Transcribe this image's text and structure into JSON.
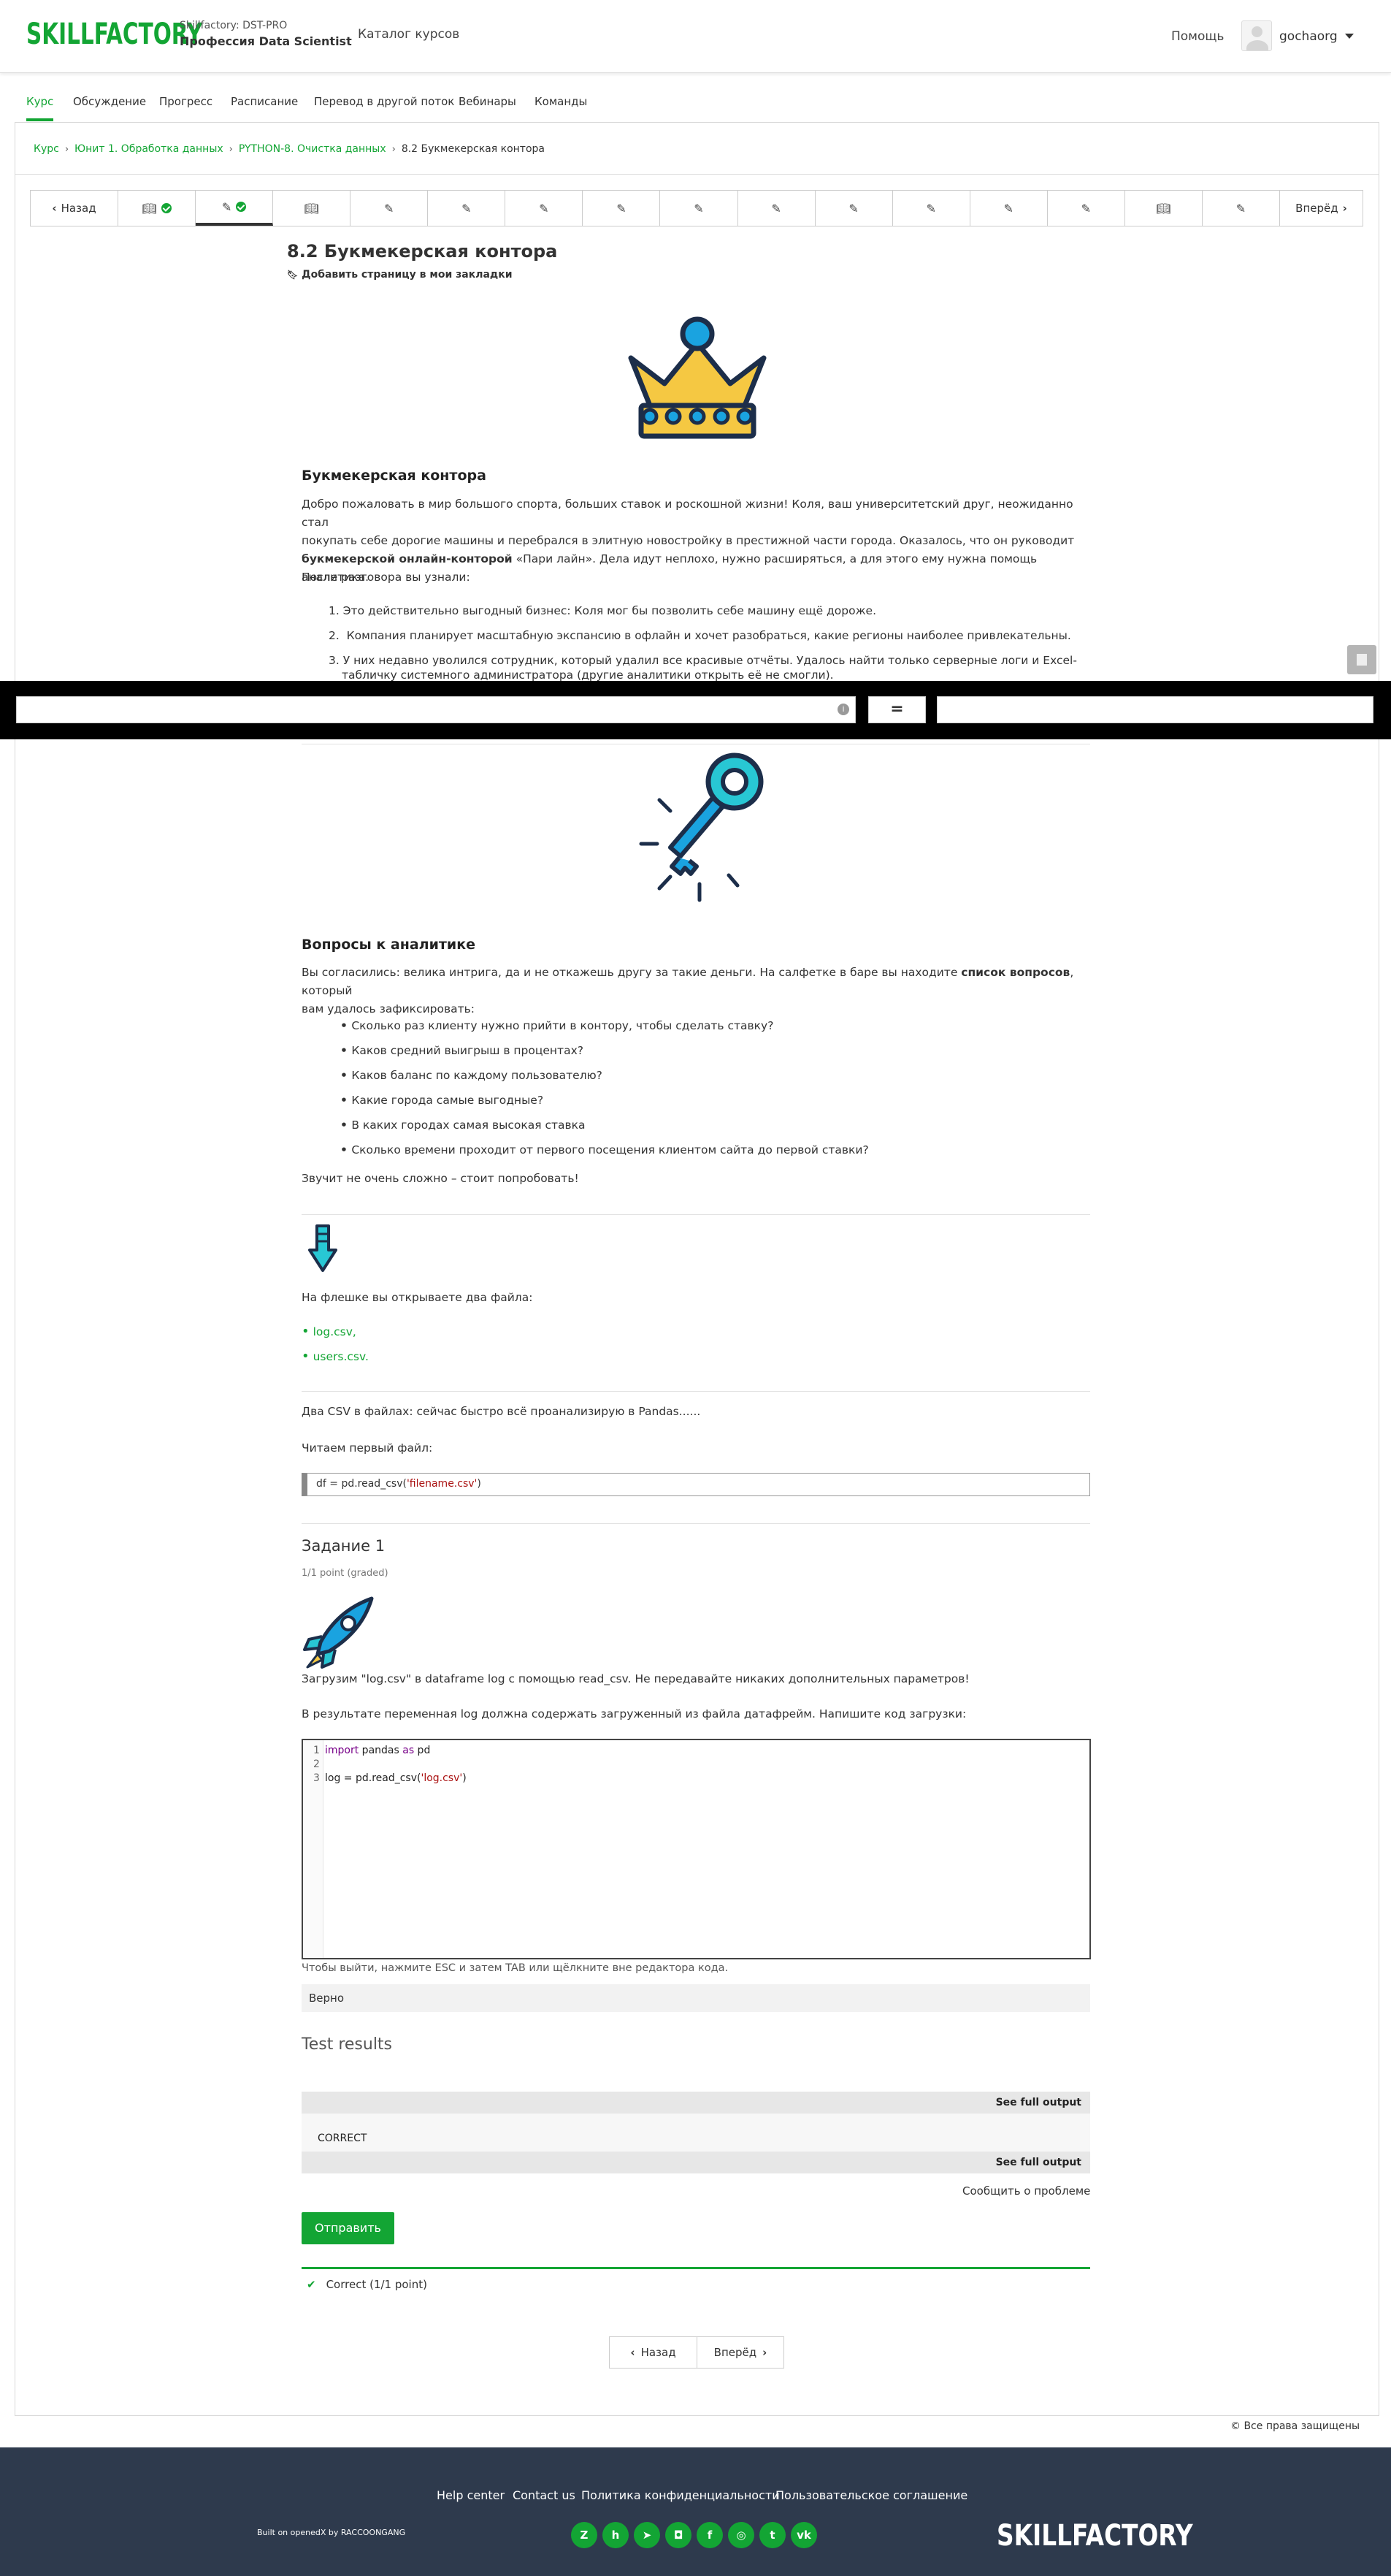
{
  "header": {
    "logo": "SKILLFACTORY",
    "org": "Skillfactory: DST-PRO",
    "program": "Профессия Data Scientist",
    "catalog": "Каталог курсов",
    "help": "Помощь",
    "username": "gochaorg"
  },
  "course_nav": {
    "tabs": [
      {
        "label": "Курс"
      },
      {
        "label": "Обсуждение"
      },
      {
        "label": "Прогресс"
      },
      {
        "label": "Расписание"
      },
      {
        "label": "Перевод в другой поток"
      },
      {
        "label": "Вебинары"
      },
      {
        "label": "Команды"
      }
    ]
  },
  "breadcrumb": {
    "items": [
      "Курс",
      "Юнит 1. Обработка данных",
      "PYTHON-8. Очистка данных",
      "8.2 Букмекерская контора"
    ]
  },
  "sequence": {
    "prev": "Назад",
    "next": "Вперёд",
    "units": [
      "book-check",
      "edit-check",
      "book",
      "edit",
      "edit",
      "edit",
      "edit",
      "edit",
      "edit",
      "edit",
      "edit",
      "edit",
      "edit",
      "book",
      "edit"
    ]
  },
  "page": {
    "title": "8.2 Букмекерская контора",
    "bookmark": "Добавить страницу в мои закладки",
    "intro_heading": "Букмекерская контора",
    "intro_p1": "Добро пожаловать в мир большого спорта, больших ставок и роскошной жизни! Коля, ваш университетский друг, неожиданно стал",
    "intro_p2a": "покупать себе дорогие машины и перебрался в элитную новостройку в престижной части города. Оказалось, что он руководит",
    "intro_p3_bold": "букмекерской онлайн-конторой",
    "intro_p3_rest": " «Пари лайн». Дела идут неплохо, нужно расширяться, а для этого ему нужна помощь аналитика.",
    "after_talk": "После разговора вы узнали:",
    "findings": [
      "Это действительно выгодный бизнес: Коля мог бы позволить себе машину ещё дороже.",
      "Компания планирует масштабную экспансию в офлайн и хочет разобраться, какие регионы наиболее привлекательны.",
      "У них недавно уволился сотрудник, который удалил все красивые отчёты. Удалось найти только серверные логи и Excel-",
      "табличку системного администратора (другие аналитики открыть её не смогли)."
    ],
    "questions_heading": "Вопросы к аналитике",
    "questions_p1a": "Вы согласились: велика интрига, да и не откажешь другу за такие деньги. На салфетке в баре вы находите ",
    "questions_p1_bold": "список вопросов",
    "questions_p1b": ", который",
    "questions_p2": "вам удалось зафиксировать:",
    "questions": [
      "Сколько раз клиенту нужно прийти в контору, чтобы сделать ставку?",
      "Каков средний выигрыш в процентах?",
      "Каков баланс по каждому пользователю?",
      "Какие города самые выгодные?",
      "В каких городах самая высокая ставка",
      "Сколько времени проходит от первого посещения клиентом сайта до первой ставки?"
    ],
    "try_it": "Звучит не очень сложно – стоит попробовать!",
    "flash_text": "На флешке вы открываете два файла:",
    "files": [
      "log.csv,",
      "users.csv."
    ],
    "csv_text": "Два CSV в файлах: сейчас быстро всё проанализирую в Pandas......",
    "read_first": "Читаем первый файл:",
    "code_snippet_pre": "df = pd.read_csv(",
    "code_snippet_str": "'filename.csv'",
    "code_snippet_post": ")"
  },
  "task": {
    "heading": "Задание 1",
    "points": "1/1 point (graded)",
    "desc1": "Загрузим \"log.csv\" в dataframe log с помощью read_csv. Не передавайте никаких дополнительных параметров!",
    "desc2": "В результате переменная log должна содержать загруженный из файла датафрейм. Напишите код загрузки:",
    "code_lines": [
      {
        "num": "1",
        "kw": "import",
        "a": " pandas ",
        "kw2": "as",
        "b": " pd",
        "str": ""
      },
      {
        "num": "2",
        "kw": "",
        "a": "",
        "kw2": "",
        "b": "",
        "str": ""
      },
      {
        "num": "3",
        "kw": "",
        "a": "log = pd.read_csv(",
        "kw2": "",
        "b": ")",
        "str": "'log.csv'"
      }
    ],
    "editor_hint": "Чтобы выйти, нажмите ESC и затем TAB или щёлкните вне редактора кода.",
    "verdict": "Верно",
    "results_heading": "Test results",
    "see_full_output": "See full output",
    "correct_label": "CORRECT",
    "report_problem": "Сообщить о проблеме",
    "submit": "Отправить",
    "status": "Correct (1/1 point)"
  },
  "pager": {
    "prev": "Назад",
    "next": "Вперёд"
  },
  "copyright": "© Все права защищены",
  "footer": {
    "links": [
      "Help center",
      "Contact us",
      "Политика конфиденциальности",
      "Пользовательское соглашение"
    ],
    "built_on": "Built on openedX by RACCOONGANG",
    "social": [
      "zen",
      "habr",
      "telegram",
      "chat",
      "facebook",
      "instagram",
      "twitter",
      "vk"
    ],
    "logo": "SKILLFACTORY"
  },
  "colors": {
    "accent": "#13a534",
    "footer_bg": "#2e3a4d"
  }
}
